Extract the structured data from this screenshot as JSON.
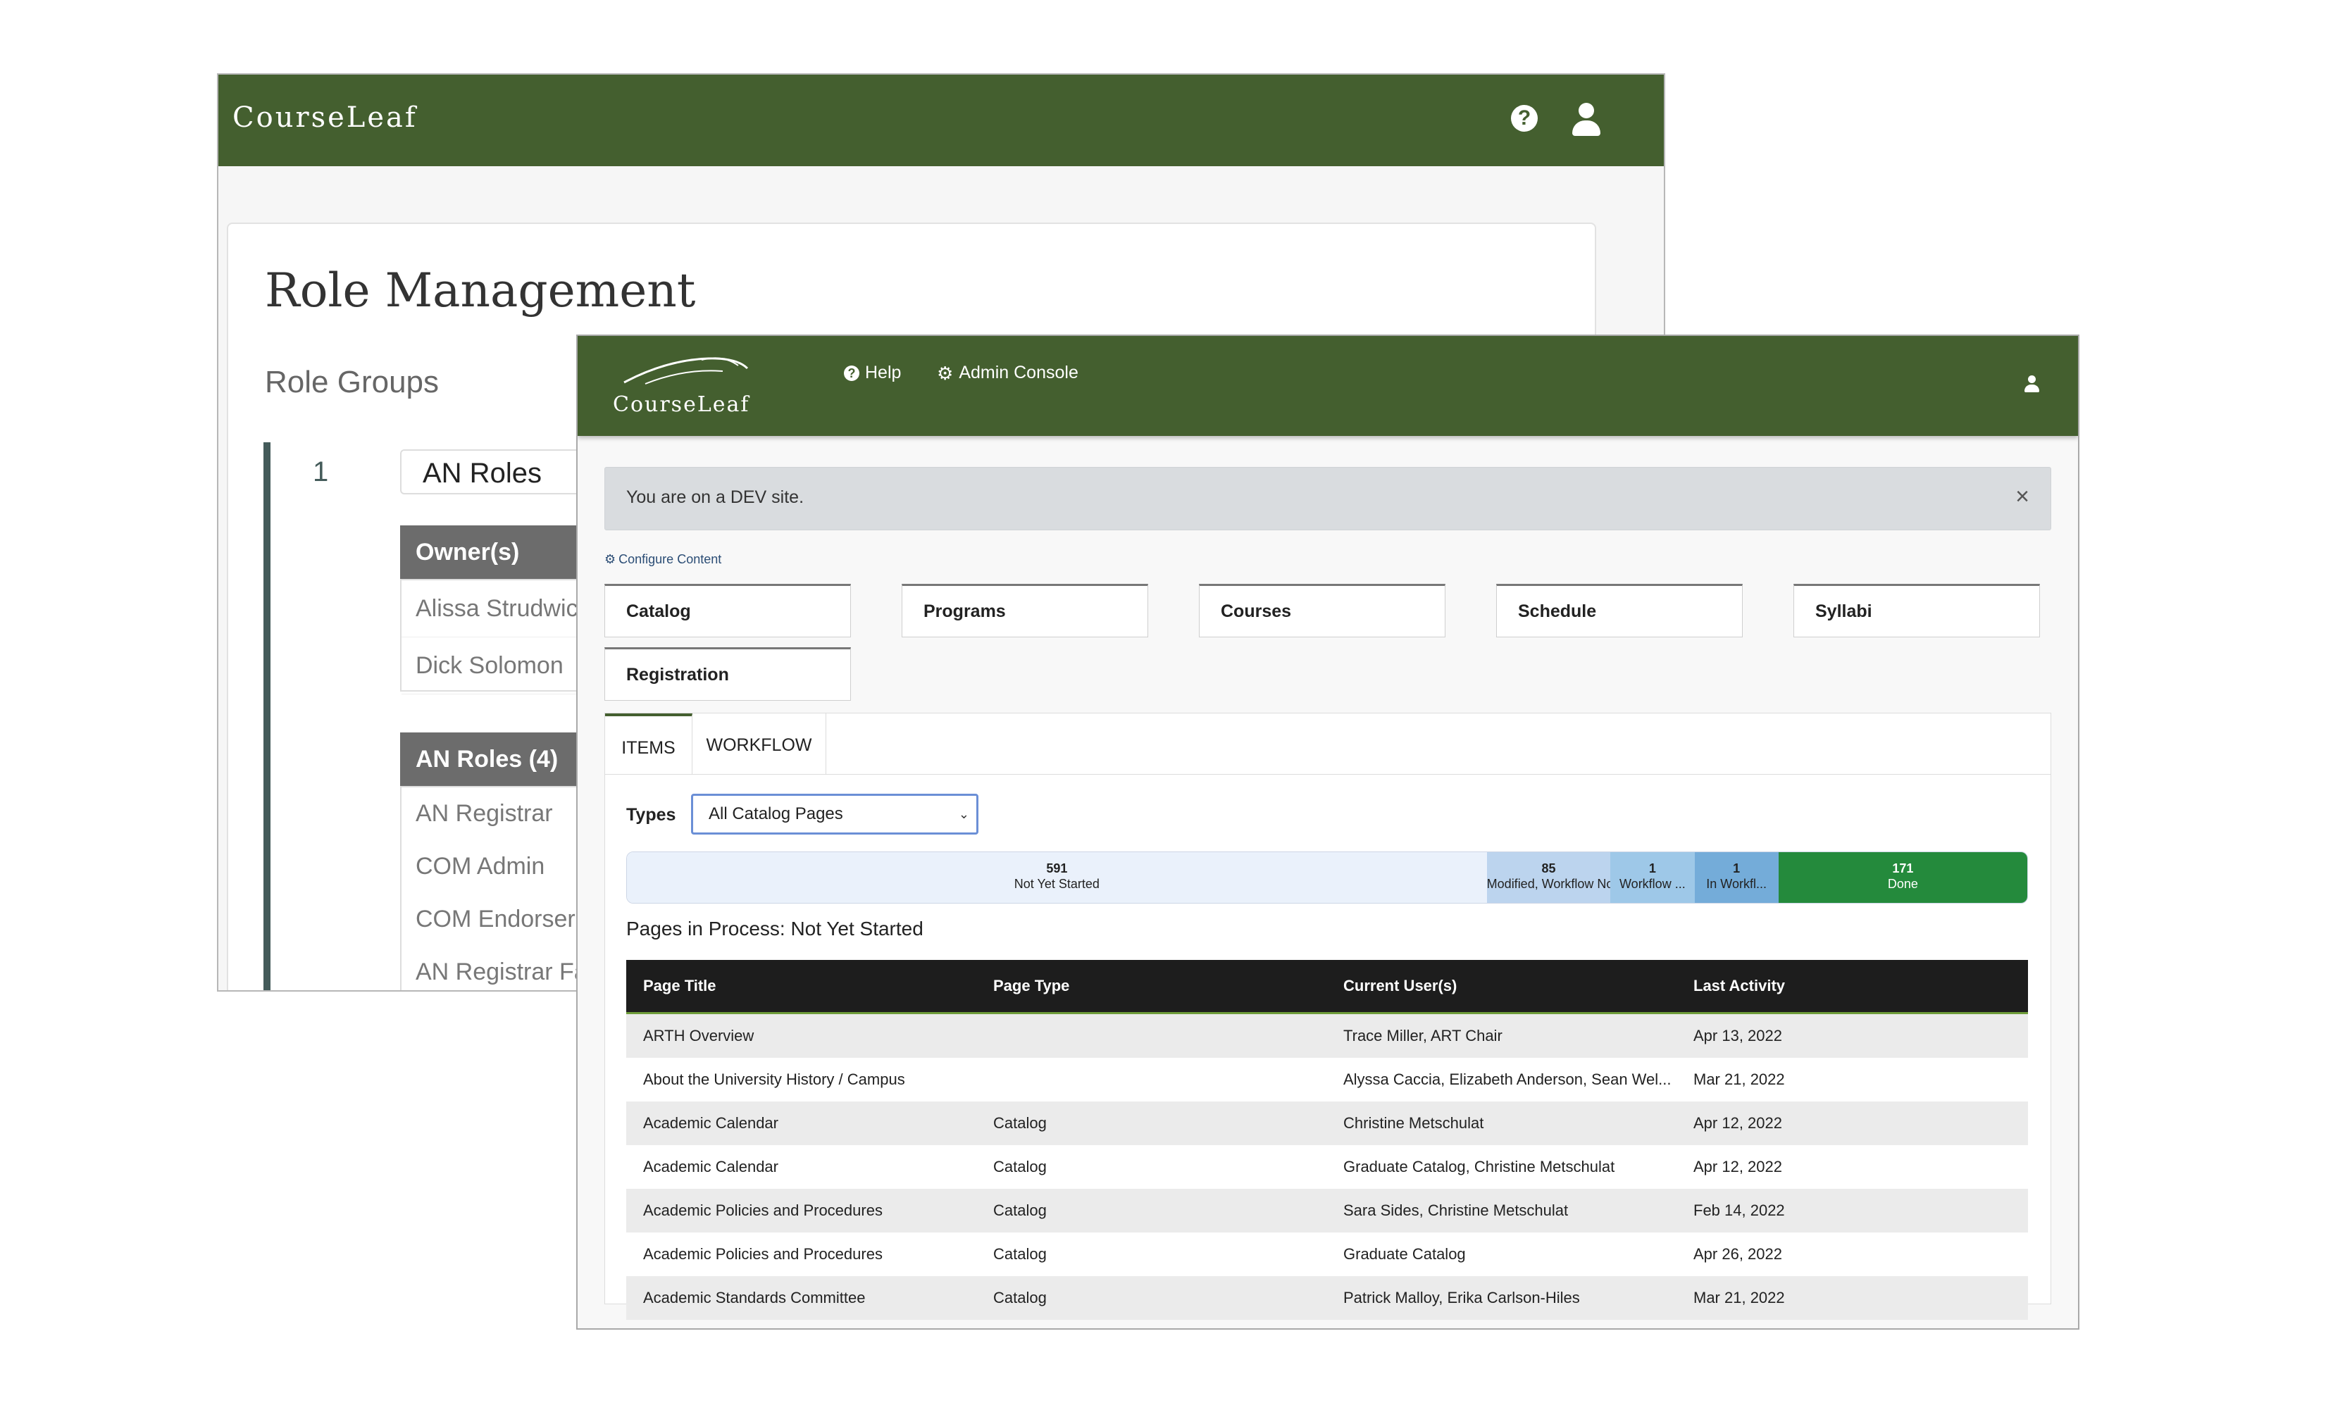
{
  "back_window": {
    "logo": "CourseLeaf",
    "help_icon": "question-circle-icon",
    "user_icon": "user-icon",
    "page_title": "Role Management",
    "section_title": "Role Groups",
    "group_number": "1",
    "group_name": "AN Roles",
    "owners_header": "Owner(s)",
    "owners": [
      "Alissa Strudwick",
      "Dick Solomon"
    ],
    "roles_header": "AN Roles (4)",
    "roles": [
      "AN Registrar",
      "COM Admin",
      "COM Endorser",
      "AN Registrar Fa"
    ]
  },
  "front_window": {
    "logo": "CourseLeaf",
    "nav": {
      "help": "Help",
      "admin_console": "Admin Console"
    },
    "banner": {
      "text": "You are on a DEV site.",
      "close": "×"
    },
    "configure_link": "Configure Content",
    "tiles": [
      "Catalog",
      "Programs",
      "Courses",
      "Schedule",
      "Syllabi",
      "Registration"
    ],
    "tabs": [
      "ITEMS",
      "WORKFLOW"
    ],
    "types": {
      "label": "Types",
      "selected": "All Catalog Pages"
    },
    "progress": [
      {
        "count": "591",
        "label": "Not Yet Started",
        "value": 591,
        "color": "#eaf1fb",
        "text_color": "#222222"
      },
      {
        "count": "85",
        "label": "Modified, Workflow Not St...",
        "value": 85,
        "color": "#bcd4ee",
        "text_color": "#222222"
      },
      {
        "count": "1",
        "label": "Workflow ...",
        "value": 1,
        "color": "#9ec8e8",
        "text_color": "#222222"
      },
      {
        "count": "1",
        "label": "In Workfl...",
        "value": 1,
        "color": "#74acd9",
        "text_color": "#222222"
      },
      {
        "count": "171",
        "label": "Done",
        "value": 171,
        "color": "#248a3c",
        "text_color": "#ffffff"
      }
    ],
    "pages_title": "Pages in Process: Not Yet Started",
    "table": {
      "headers": [
        "Page Title",
        "Page Type",
        "Current User(s)",
        "Last Activity"
      ],
      "rows": [
        [
          "ARTH Overview",
          "",
          "Trace Miller, ART Chair",
          "Apr 13, 2022"
        ],
        [
          "About the University History / Campus",
          "",
          "Alyssa Caccia, Elizabeth Anderson, Sean Wel...",
          "Mar 21, 2022"
        ],
        [
          "Academic Calendar",
          "Catalog",
          "Christine Metschulat",
          "Apr 12, 2022"
        ],
        [
          "Academic Calendar",
          "Catalog",
          "Graduate Catalog, Christine Metschulat",
          "Apr 12, 2022"
        ],
        [
          "Academic Policies and Procedures",
          "Catalog",
          "Sara Sides, Christine Metschulat",
          "Feb 14, 2022"
        ],
        [
          "Academic Policies and Procedures",
          "Catalog",
          "Graduate Catalog",
          "Apr 26, 2022"
        ],
        [
          "Academic Standards Committee",
          "Catalog",
          "Patrick Malloy, Erika Carlson-Hiles",
          "Mar 21, 2022"
        ]
      ]
    }
  },
  "colors": {
    "header_green": "#445f2f",
    "table_header": "#1d1d1d",
    "done_green": "#248a3c"
  }
}
